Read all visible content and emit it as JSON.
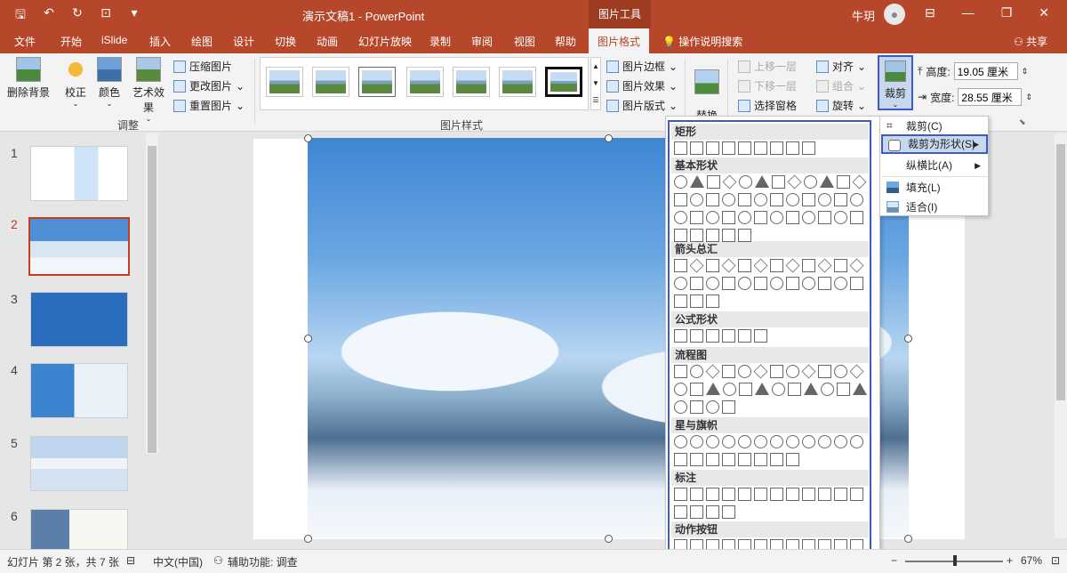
{
  "title_bar": {
    "doc_title": "演示文稿1  -  PowerPoint",
    "context_tab": "图片工具",
    "user_name": "牛玥"
  },
  "tabs": [
    "文件",
    "开始",
    "iSlide",
    "插入",
    "绘图",
    "设计",
    "切换",
    "动画",
    "幻灯片放映",
    "录制",
    "审阅",
    "视图",
    "帮助"
  ],
  "active_tab": "图片格式",
  "tell_me": "操作说明搜索",
  "share": "共享",
  "ribbon": {
    "remove_bg": "删除背景",
    "corrections": "校正",
    "color": "颜色",
    "artistic": "艺术效果",
    "compress": "压缩图片",
    "change": "更改图片",
    "reset": "重置图片",
    "adjust_group": "调整",
    "styles_group": "图片样式",
    "border": "图片边框",
    "effects": "图片效果",
    "layout": "图片版式",
    "alt_text": "替换\n文字",
    "bring_forward": "上移一层",
    "send_backward": "下移一层",
    "selection_pane": "选择窗格",
    "align": "对齐",
    "group": "组合",
    "rotate": "旋转",
    "crop": "裁剪",
    "height_label": "高度:",
    "height_value": "19.05 厘米",
    "width_label": "宽度:",
    "width_value": "28.55 厘米"
  },
  "slides": [
    {
      "num": "1"
    },
    {
      "num": "2",
      "active": true
    },
    {
      "num": "3"
    },
    {
      "num": "4"
    },
    {
      "num": "5"
    },
    {
      "num": "6"
    }
  ],
  "shapes_menu": {
    "categories": [
      "矩形",
      "基本形状",
      "箭头总汇",
      "公式形状",
      "流程图",
      "星与旗帜",
      "标注",
      "动作按钮"
    ]
  },
  "crop_menu": {
    "items": [
      "裁剪(C)",
      "裁剪为形状(S)",
      "纵横比(A)",
      "填充(L)",
      "适合(I)"
    ]
  },
  "status": {
    "slide_info": "幻灯片 第 2 张，共 7 张",
    "language": "中文(中国)",
    "accessibility": "辅助功能: 调查",
    "zoom": "67%"
  },
  "colors": {
    "accent": "#b7472a",
    "highlight_border": "#3b5cc4",
    "highlight_fill": "#c6d7ee"
  }
}
